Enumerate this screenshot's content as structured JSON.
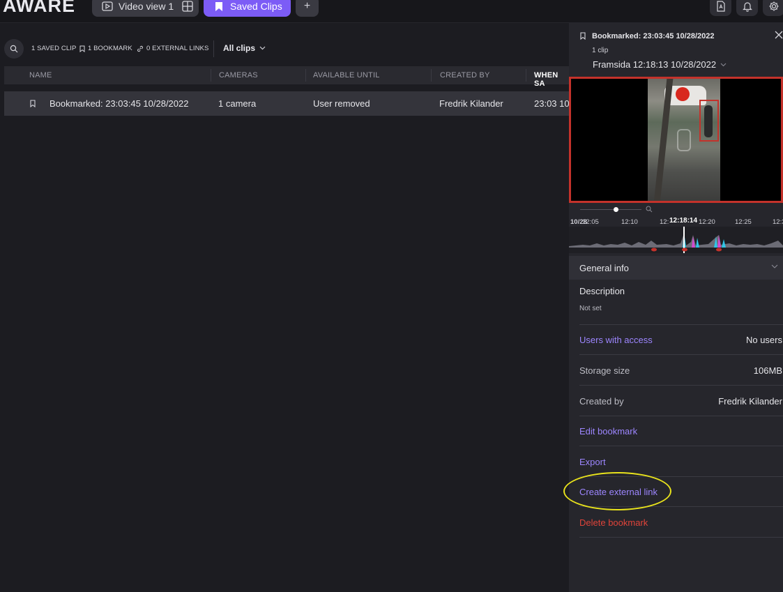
{
  "app": {
    "logo": "AWARE"
  },
  "tabs": [
    {
      "label": "Video view 1",
      "icon": "play-icon",
      "extra_icon": "grid-icon"
    },
    {
      "label": "Saved Clips",
      "icon": "bookmark-icon",
      "active": true
    },
    {
      "label": "+",
      "icon": "plus-icon"
    }
  ],
  "top_icons": [
    "document-icon",
    "bell-icon",
    "gear-icon"
  ],
  "filters": {
    "saved_clips": "1 SAVED CLIP",
    "bookmarks": "1 BOOKMARK",
    "external_links": "0 EXTERNAL LINKS",
    "view": "All clips"
  },
  "table": {
    "columns": [
      "NAME",
      "CAMERAS",
      "AVAILABLE UNTIL",
      "CREATED BY",
      "WHEN SA"
    ],
    "rows": [
      {
        "name": "Bookmarked: 23:03:45 10/28/2022",
        "cameras": "1 camera",
        "available_until": "User removed",
        "created_by": "Fredrik Kilander",
        "when_saved": "23:03 10"
      }
    ]
  },
  "panel": {
    "title": "Bookmarked: 23:03:45 10/28/2022",
    "clip_count": "1 clip",
    "camera": "Framsida 12:18:13 10/28/2022",
    "timeline": {
      "labels": [
        "10/28",
        "12:05",
        "12:10",
        "12:",
        "12:20",
        "12:25",
        "12:3"
      ],
      "current": "12:18:14"
    },
    "general_info": "General info",
    "description_label": "Description",
    "description_value": "Not set",
    "rows": [
      {
        "label": "Users with access",
        "value": "No users",
        "style": "link"
      },
      {
        "label": "Storage size",
        "value": "106MB",
        "style": "plain"
      },
      {
        "label": "Created by",
        "value": "Fredrik Kilander",
        "style": "plain"
      }
    ],
    "actions": {
      "edit": "Edit bookmark",
      "export": "Export",
      "external_link": "Create external link",
      "delete": "Delete bookmark"
    }
  },
  "colors": {
    "accent": "#7c5cf6",
    "link": "#9d86ff",
    "danger": "#e0443a",
    "highlight": "#e8e21c"
  }
}
